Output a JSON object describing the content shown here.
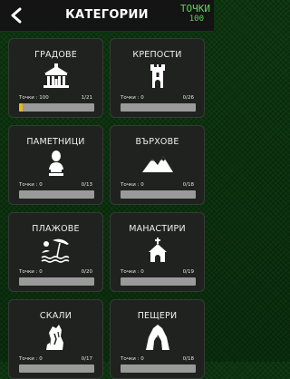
{
  "header": {
    "title": "КАТЕГОРИИ",
    "points_label": "ТОЧКИ",
    "points_value": "100"
  },
  "categories": [
    {
      "name": "ГРАДОВЕ",
      "icon": "town-hall-icon",
      "points_text": "Точки : 100",
      "count": "1/21",
      "progress": 0.048
    },
    {
      "name": "КРЕПОСТИ",
      "icon": "fortress-icon",
      "points_text": "Точки : 0",
      "count": "0/26",
      "progress": 0
    },
    {
      "name": "ПАМЕТНИЦИ",
      "icon": "bust-icon",
      "points_text": "Точки : 0",
      "count": "0/13",
      "progress": 0
    },
    {
      "name": "ВЪРХОВЕ",
      "icon": "mountain-icon",
      "points_text": "Точки : 0",
      "count": "0/18",
      "progress": 0
    },
    {
      "name": "ПЛАЖОВЕ",
      "icon": "beach-icon",
      "points_text": "Точки : 0",
      "count": "0/20",
      "progress": 0
    },
    {
      "name": "МАНАСТИРИ",
      "icon": "monastery-icon",
      "points_text": "Точки : 0",
      "count": "0/19",
      "progress": 0
    },
    {
      "name": "СКАЛИ",
      "icon": "rocks-icon",
      "points_text": "Точки : 0",
      "count": "0/17",
      "progress": 0
    },
    {
      "name": "ПЕЩЕРИ",
      "icon": "cave-icon",
      "points_text": "Точки : 0",
      "count": "0/18",
      "progress": 0
    }
  ],
  "colors": {
    "accent_green": "#5fd35a",
    "progress_yellow": "#e7b820",
    "card_bg": "#1f221f"
  }
}
